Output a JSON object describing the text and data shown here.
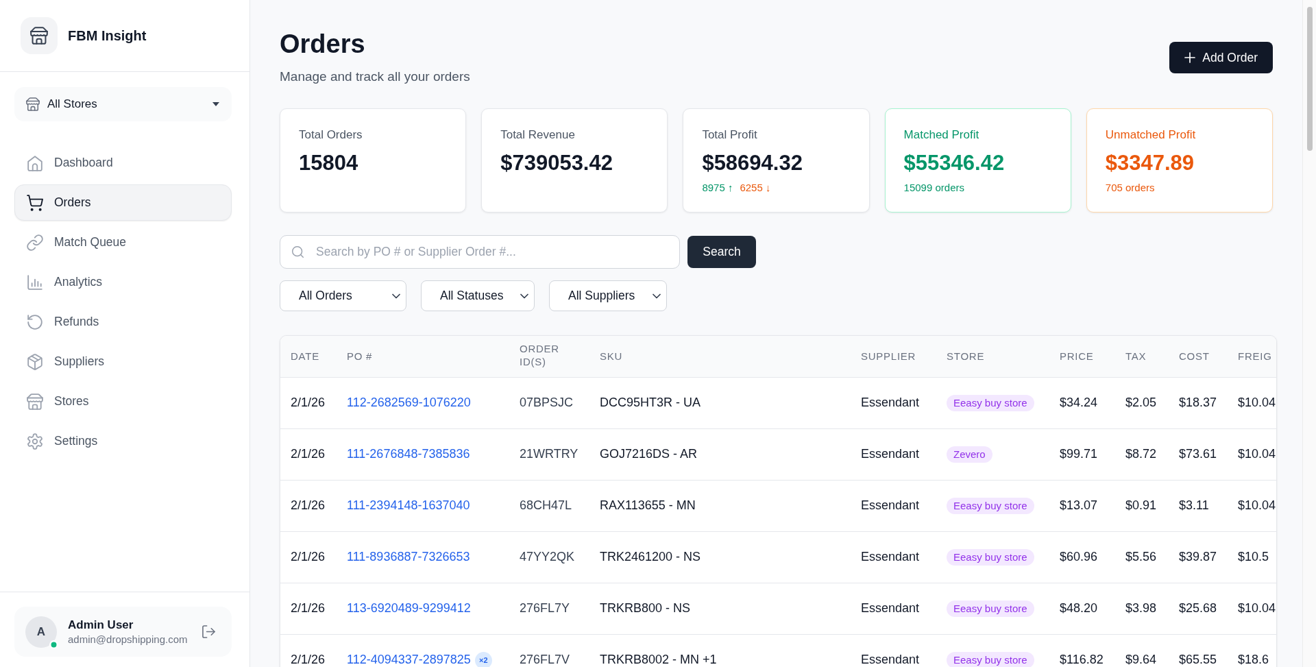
{
  "sidebar": {
    "brand": "FBM Insight",
    "store_select": {
      "value": "All Stores"
    },
    "nav": [
      {
        "label": "Dashboard",
        "selected": false
      },
      {
        "label": "Orders",
        "selected": true
      },
      {
        "label": "Match Queue",
        "selected": false
      },
      {
        "label": "Analytics",
        "selected": false
      },
      {
        "label": "Refunds",
        "selected": false
      },
      {
        "label": "Suppliers",
        "selected": false
      },
      {
        "label": "Stores",
        "selected": false
      },
      {
        "label": "Settings",
        "selected": false
      }
    ],
    "user": {
      "initial": "A",
      "name": "Admin User",
      "email": "admin@dropshipping.com",
      "online": true
    }
  },
  "header": {
    "title": "Orders",
    "subtitle": "Manage and track all your orders",
    "add_button": "Add Order"
  },
  "stats": [
    {
      "kind": "neutral",
      "label": "Total Orders",
      "value": "15804"
    },
    {
      "kind": "neutral",
      "label": "Total Revenue",
      "value": "$739053.42"
    },
    {
      "kind": "neutral",
      "label": "Total Profit",
      "value": "$58694.32",
      "up": "8975 ↑",
      "down": "6255 ↓"
    },
    {
      "kind": "positive",
      "label": "Matched Profit",
      "value": "$55346.42",
      "note": "15099 orders"
    },
    {
      "kind": "negative",
      "label": "Unmatched Profit",
      "value": "$3347.89",
      "note": "705 orders"
    }
  ],
  "search": {
    "placeholder": "Search by PO # or Supplier Order #...",
    "button": "Search"
  },
  "filters": [
    {
      "value": "All Orders"
    },
    {
      "value": "All Statuses"
    },
    {
      "value": "All Suppliers"
    }
  ],
  "table": {
    "columns": [
      "DATE",
      "PO #",
      "ORDER ID(S)",
      "SKU",
      "SUPPLIER",
      "STORE",
      "PRICE",
      "TAX",
      "COST",
      "FREIG"
    ],
    "rows": [
      {
        "date": "2/1/26",
        "po": "112-2682569-1076220",
        "order_ids": "07BPSJC",
        "sku": "DCC95HT3R - UA",
        "supplier": "Essendant",
        "store": "Eeasy buy store",
        "price": "$34.24",
        "tax": "$2.05",
        "cost": "$18.37",
        "column_10": "$10.04"
      },
      {
        "date": "2/1/26",
        "po": "111-2676848-7385836",
        "order_ids": "21WRTRY",
        "sku": "GOJ7216DS - AR",
        "supplier": "Essendant",
        "store": "Zevero",
        "price": "$99.71",
        "tax": "$8.72",
        "cost": "$73.61",
        "column_10": "$10.04"
      },
      {
        "date": "2/1/26",
        "po": "111-2394148-1637040",
        "order_ids": "68CH47L",
        "sku": "RAX113655 - MN",
        "supplier": "Essendant",
        "store": "Eeasy buy store",
        "price": "$13.07",
        "tax": "$0.91",
        "cost": "$3.11",
        "column_10": "$10.04"
      },
      {
        "date": "2/1/26",
        "po": "111-8936887-7326653",
        "order_ids": "47YY2QK",
        "sku": "TRK2461200 - NS",
        "supplier": "Essendant",
        "store": "Eeasy buy store",
        "price": "$60.96",
        "tax": "$5.56",
        "cost": "$39.87",
        "column_10": "$10.5"
      },
      {
        "date": "2/1/26",
        "po": "113-6920489-9299412",
        "order_ids": "276FL7Y",
        "sku": "TRKRB800 - NS",
        "supplier": "Essendant",
        "store": "Eeasy buy store",
        "price": "$48.20",
        "tax": "$3.98",
        "cost": "$25.68",
        "column_10": "$10.04"
      },
      {
        "date": "2/1/26",
        "po": "112-4094337-2897825",
        "po_count": "×2",
        "order_ids": "276FL7V",
        "sku": "TRKRB8002 - MN +1",
        "supplier": "Essendant",
        "store": "Eeasy buy store",
        "price": "$116.82",
        "tax": "$9.64",
        "cost": "$65.55",
        "column_10": "$18.6"
      }
    ]
  }
}
